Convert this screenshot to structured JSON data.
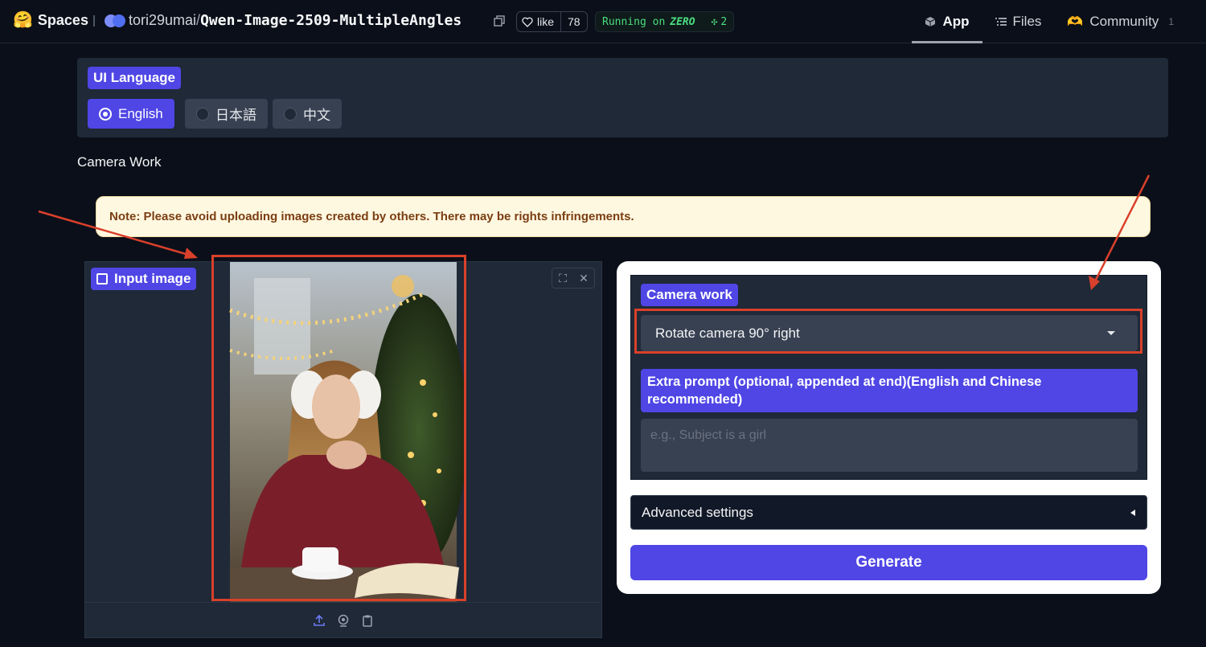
{
  "topbar": {
    "brand_emoji": "🤗",
    "brand_name": "Spaces",
    "owner": "tori29umai",
    "slash": "/",
    "repo_name": "Qwen-Image-2509-MultipleAngles",
    "like_label": "like",
    "like_count": "78",
    "status_prefix": "Running on",
    "status_hw": "ZERO",
    "status_count": "2",
    "tabs": [
      {
        "label": "App",
        "icon": "cube-icon"
      },
      {
        "label": "Files",
        "icon": "files-icon"
      },
      {
        "label": "Community",
        "icon": "community-icon",
        "badge": "1"
      }
    ]
  },
  "language": {
    "label": "UI Language",
    "options": [
      "English",
      "日本語",
      "中文"
    ],
    "selected": "English"
  },
  "section_title": "Camera Work",
  "note": "Note: Please avoid uploading images created by others. There may be rights infringements.",
  "input_image": {
    "label": "Input image",
    "icons": [
      "fullscreen-icon",
      "close-icon",
      "upload-icon",
      "webcam-icon",
      "clipboard-icon"
    ]
  },
  "camera": {
    "label": "Camera work",
    "value": "Rotate camera 90° right",
    "extra_label": "Extra prompt (optional, appended at end)(English and Chinese recommended)",
    "extra_placeholder": "e.g., Subject is a girl"
  },
  "advanced_label": "Advanced settings",
  "generate_label": "Generate",
  "colors": {
    "background": "#0b0f19",
    "panel": "#1f2937",
    "accent": "#4f46e5",
    "annotation": "#d9402b",
    "note_bg": "#fff8e1"
  }
}
